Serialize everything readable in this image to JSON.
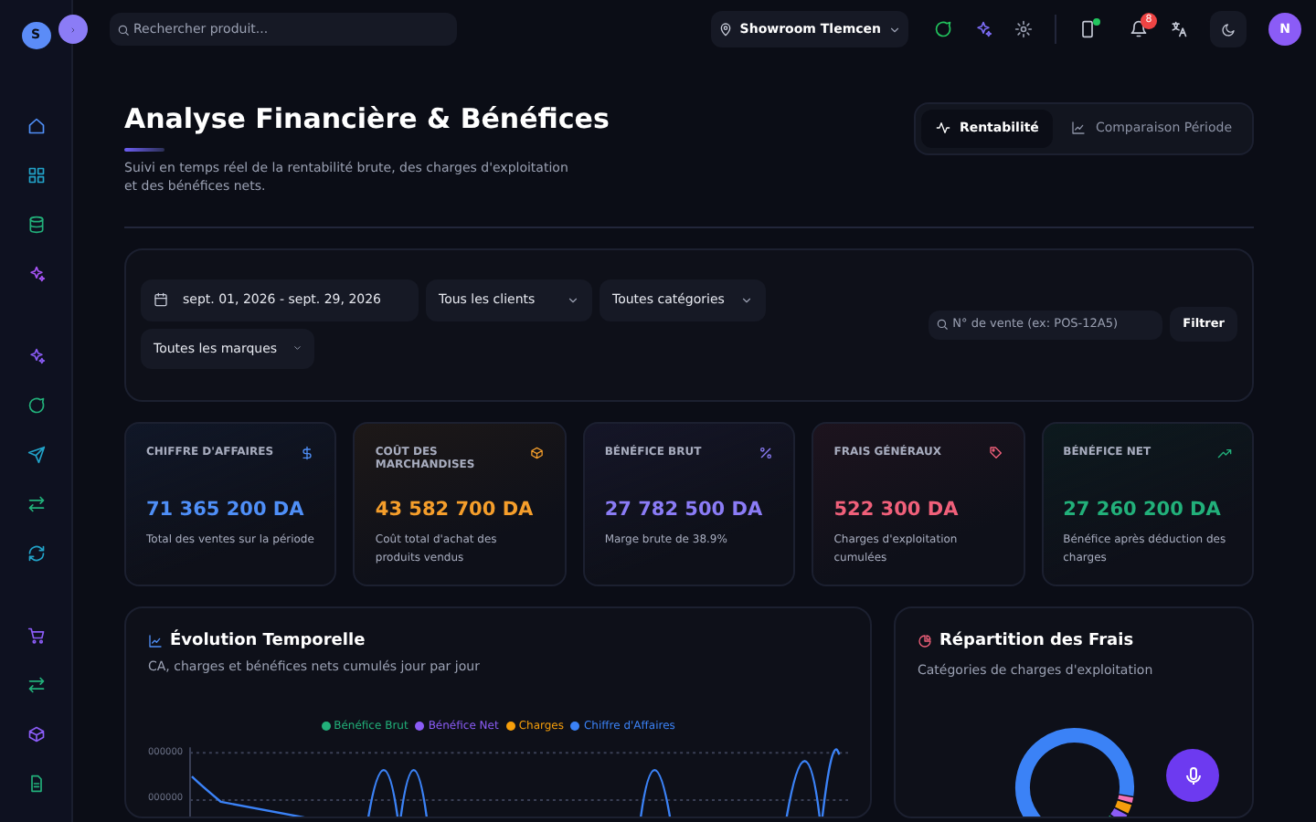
{
  "sidebar": {
    "avatar": "S"
  },
  "topbar": {
    "search_placeholder": "Rechercher produit...",
    "location": "Showroom Tlemcen",
    "notification_count": "8",
    "user_avatar": "N"
  },
  "header": {
    "title": "Analyse Financière & Bénéfices",
    "subtitle": "Suivi en temps réel de la rentabilité brute, des charges d'exploitation et des bénéfices nets."
  },
  "tabs": [
    {
      "label": "Rentabilité",
      "selected": true
    },
    {
      "label": "Comparaison Période",
      "selected": false
    }
  ],
  "filters": {
    "date_range": "sept. 01, 2026 - sept. 29, 2026",
    "selects": [
      "Tous les clients",
      "Toutes catégories",
      "Toutes les marques"
    ],
    "sale_search_placeholder": "N° de vente (ex: POS-12A5)",
    "filter_button": "Filtrer"
  },
  "stats": [
    {
      "title": "CHIFFRE D'AFFAIRES",
      "value": "71 365 200 DA",
      "note": "Total des ventes sur la période",
      "color": "#4f8ff7"
    },
    {
      "title": "COÛT DES MARCHANDISES",
      "value": "43 582 700 DA",
      "note": "Coût total d'achat des produits vendus",
      "color": "#f59e2b"
    },
    {
      "title": "BÉNÉFICE BRUT",
      "value": "27 782 500 DA",
      "note": "Marge brute de 38.9%",
      "color": "#8b7cf6"
    },
    {
      "title": "FRAIS GÉNÉRAUX",
      "value": "522 300 DA",
      "note": "Charges d'exploitation cumulées",
      "color": "#f0607a"
    },
    {
      "title": "BÉNÉFICE NET",
      "value": "27 260 200 DA",
      "note": "Bénéfice après déduction des charges",
      "color": "#22b07a"
    }
  ],
  "evolution": {
    "title": "Évolution Temporelle",
    "subtitle": "CA, charges et bénéfices nets cumulés jour par jour",
    "legend": [
      {
        "label": "Bénéfice Brut",
        "color": "#22b07a"
      },
      {
        "label": "Bénéfice Net",
        "color": "#8b5cf6"
      },
      {
        "label": "Charges",
        "color": "#f59e0b"
      },
      {
        "label": "Chiffre d'Affaires",
        "color": "#3b82f6"
      }
    ],
    "axis_labels": [
      "000000",
      "000000"
    ]
  },
  "expenses": {
    "title": "Répartition des Frais",
    "subtitle": "Catégories de charges d'exploitation"
  }
}
